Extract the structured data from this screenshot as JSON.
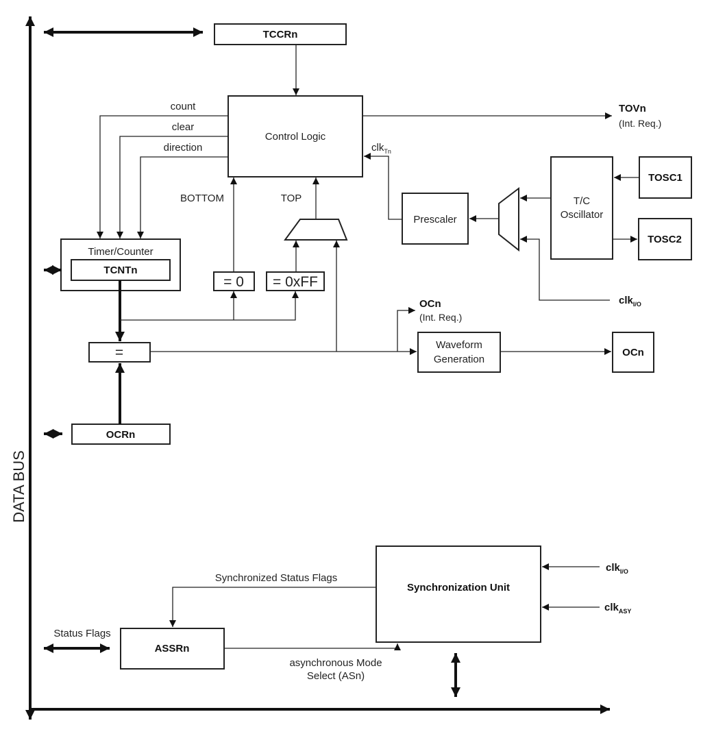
{
  "bus_label": "DATA BUS",
  "blocks": {
    "tccr": "TCCRn",
    "control_logic": "Control Logic",
    "timer_counter": "Timer/Counter",
    "tcnt": "TCNTn",
    "eq_zero": "= 0",
    "eq_ff": "= 0xFF",
    "comparator": "=",
    "ocr": "OCRn",
    "waveform_line1": "Waveform",
    "waveform_line2": "Generation",
    "ocn_pin": "OCn",
    "prescaler": "Prescaler",
    "osc_line1": "T/C",
    "osc_line2": "Oscillator",
    "tosc1": "TOSC1",
    "tosc2": "TOSC2",
    "sync_unit": "Synchronization Unit",
    "assr": "ASSRn"
  },
  "signals": {
    "count": "count",
    "clear": "clear",
    "direction": "direction",
    "bottom": "BOTTOM",
    "top": "TOP",
    "tov": "TOVn",
    "tov_sub": "(Int. Req.)",
    "clkt": "clk",
    "clkt_sub": "Tn",
    "ocn_int": "OCn",
    "ocn_int_sub": "(Int. Req.)",
    "clkio": "clk",
    "clkio_sub": "I/O",
    "clkio2": "clk",
    "clkio2_sub": "I/O",
    "clkasy": "clk",
    "clkasy_sub": "ASY",
    "sync_flags": "Synchronized Status Flags",
    "status_flags": "Status Flags",
    "async_line1": "asynchronous Mode",
    "async_line2": "Select (ASn)"
  }
}
